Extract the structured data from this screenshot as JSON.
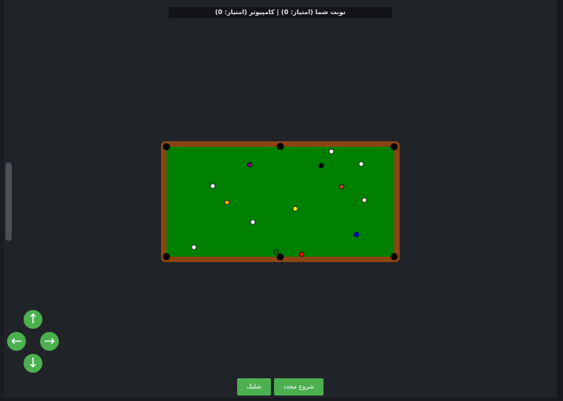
{
  "header": {
    "status_text": "نوبت شما (امتیاز: 0) | کامپیوتر (امتیاز: 0)"
  },
  "controls": {
    "up_label": "↑",
    "left_label": "←",
    "right_label": "→",
    "down_label": "↓",
    "shoot_label": "شلیک",
    "restart_label": "شروع مجدد"
  },
  "table": {
    "rail_color": "#8b4513",
    "felt_color": "#008000",
    "pocket_color": "#000000",
    "balls": [
      {
        "name": "white",
        "color": "#ffffff"
      },
      {
        "name": "purple",
        "color": "#800080"
      },
      {
        "name": "black",
        "color": "#000000"
      },
      {
        "name": "cream",
        "color": "#f5f5dc"
      },
      {
        "name": "white",
        "color": "#ffffff"
      },
      {
        "name": "brown",
        "color": "#a0522d"
      },
      {
        "name": "orange",
        "color": "#ffa500"
      },
      {
        "name": "yellow",
        "color": "#ffff00"
      },
      {
        "name": "cream",
        "color": "#f5f5dc"
      },
      {
        "name": "white",
        "color": "#ffffff"
      },
      {
        "name": "blue",
        "color": "#0000ff"
      },
      {
        "name": "white",
        "color": "#ffffff"
      },
      {
        "name": "green",
        "color": "#008000"
      },
      {
        "name": "red",
        "color": "#ff0000"
      }
    ]
  }
}
